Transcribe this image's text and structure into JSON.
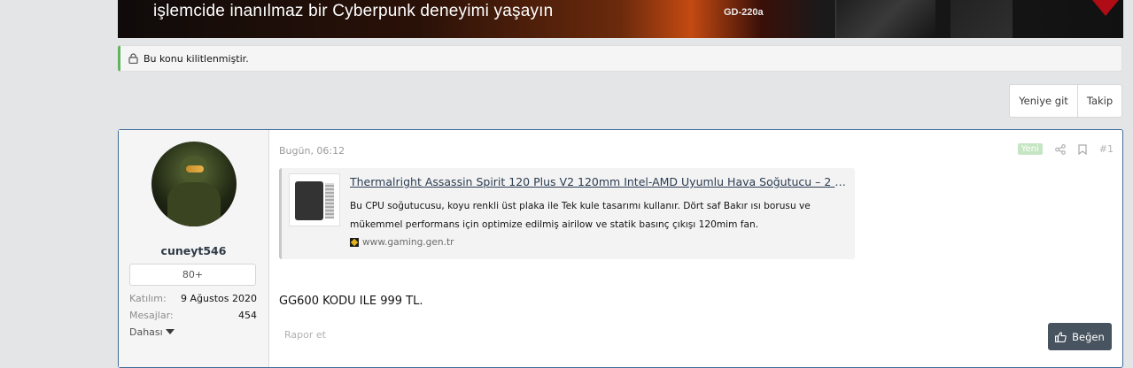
{
  "banner": {
    "text": "işlemcide inanılmaz bir Cyberpunk deneyimi yaşayın",
    "model": "GD-220a"
  },
  "notice": {
    "text": "Bu konu kilitlenmiştir."
  },
  "buttons": {
    "go_new": "Yeniye git",
    "follow": "Takip"
  },
  "post": {
    "user": {
      "name": "cuneyt546",
      "rank": "80+",
      "joined_label": "Katılım:",
      "joined_value": "9 Ağustos 2020",
      "messages_label": "Mesajlar:",
      "messages_value": "454",
      "more_label": "Dahası"
    },
    "date": "Bugün, 06:12",
    "new_badge": "Yeni",
    "number": "#1",
    "unfurl": {
      "title": "Thermalright Assassin Spirit 120 Plus V2 120mm Intel-AMD Uyumlu Hava Soğutucu – 2 Yıl…",
      "description": "Bu CPU soğutucusu, koyu renkli üst plaka ile Tek kule tasarımı kullanır. Dört saf Bakır ısı borusu ve mükemmel performans için optimize edilmiş airilow ve statik basınç çıkışı 120mim fan.",
      "site": "www.gaming.gen.tr"
    },
    "message": "GG600 KODU ILE 999 TL.",
    "report_label": "Rapor et",
    "like_label": "Beğen"
  },
  "colors": {
    "accent_border": "#3f6b99",
    "locked_green": "#63b361",
    "like_button": "#47535f"
  },
  "icons": [
    "lock-icon",
    "share-icon",
    "bookmark-icon",
    "caret-down-icon",
    "thumbs-up-icon",
    "favicon-icon"
  ]
}
